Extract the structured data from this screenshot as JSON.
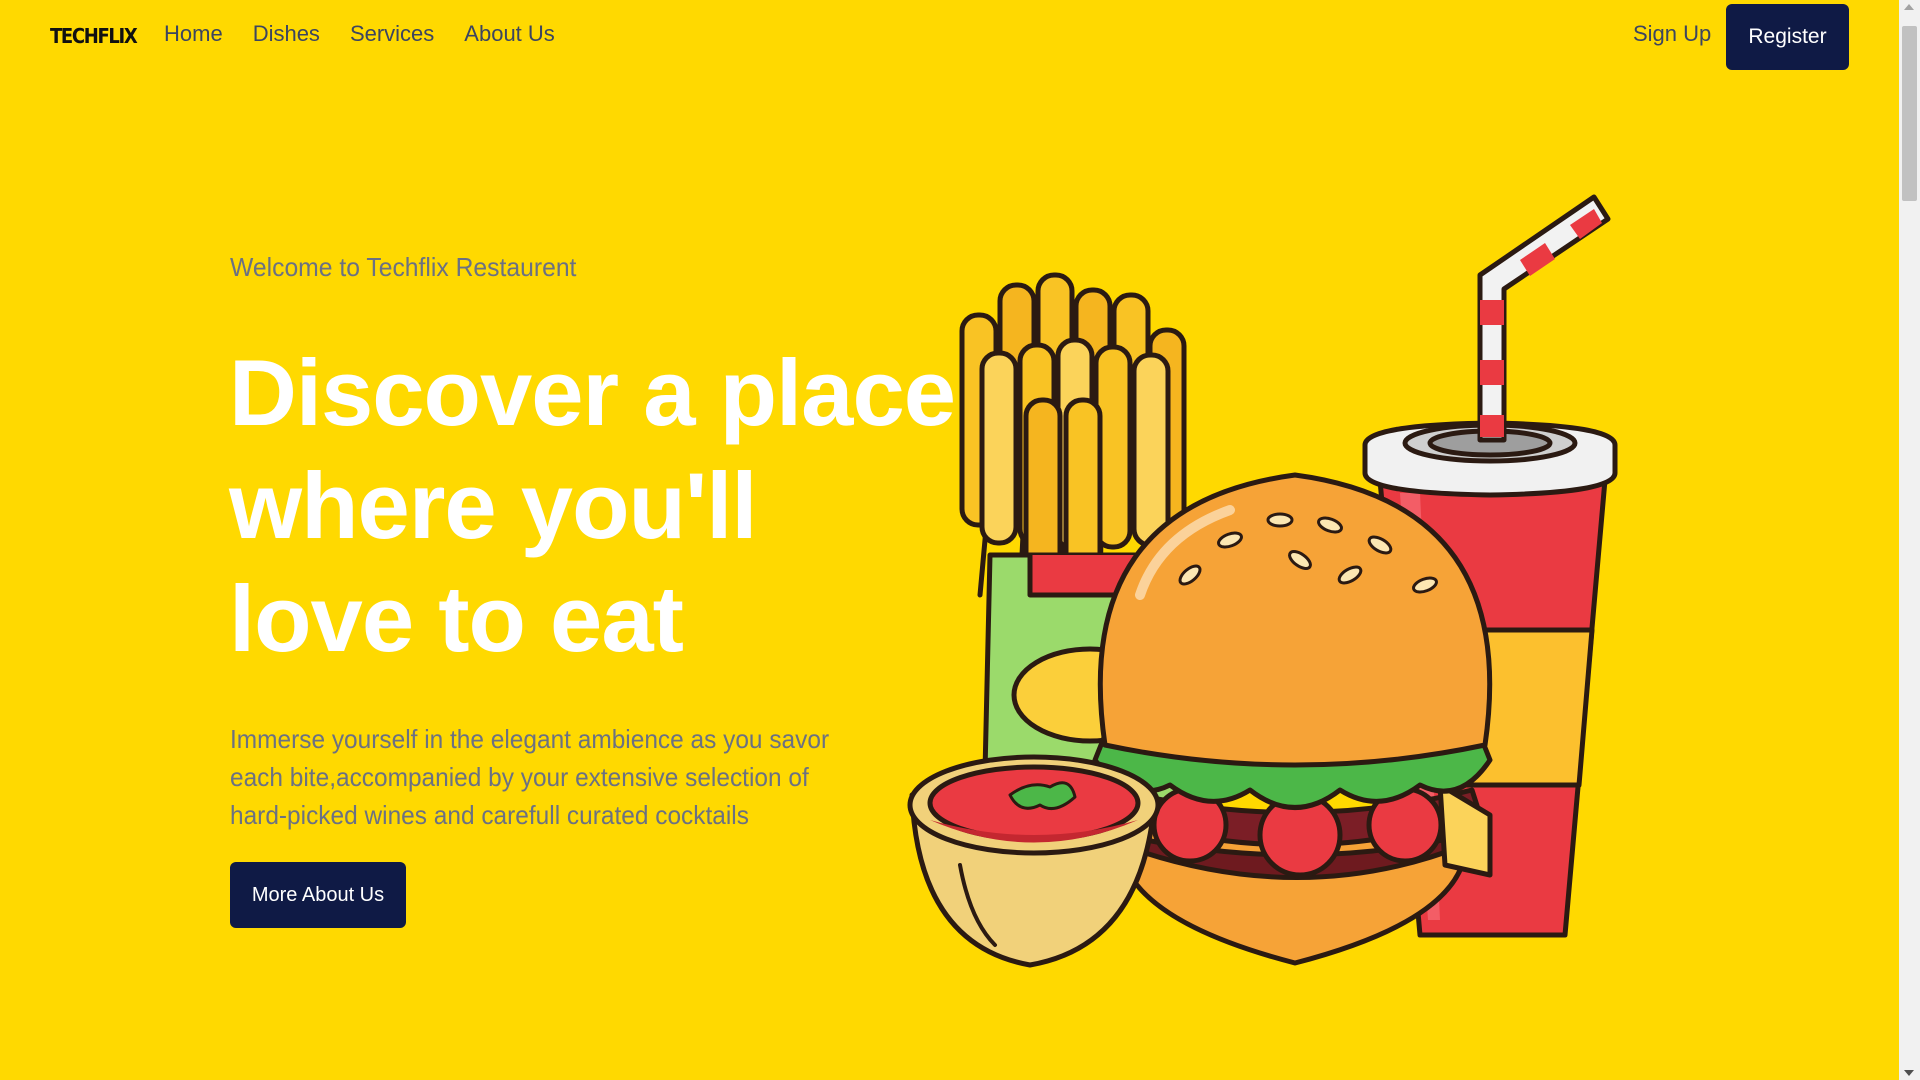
{
  "brand": {
    "logo_text": "TECHFLIX"
  },
  "nav": {
    "links": [
      "Home",
      "Dishes",
      "Services",
      "About Us"
    ],
    "signup_label": "Sign Up",
    "register_label": "Register"
  },
  "hero": {
    "welcome": "Welcome to Techflix Restaurent",
    "headline_lines": [
      "Discover a place",
      "where you'll",
      "love to eat"
    ],
    "description": "Immerse yourself in the elegant ambience as you savor each bite,accompanied by your extensive selection of hard-picked wines and carefull curated cocktails",
    "cta_label": "More About Us",
    "illustration_icon": "fast-food-illustration"
  },
  "colors": {
    "background": "#FFD900",
    "button": "#0F1A45",
    "headline": "#FFFFFF",
    "muted_text": "#6B7183"
  }
}
